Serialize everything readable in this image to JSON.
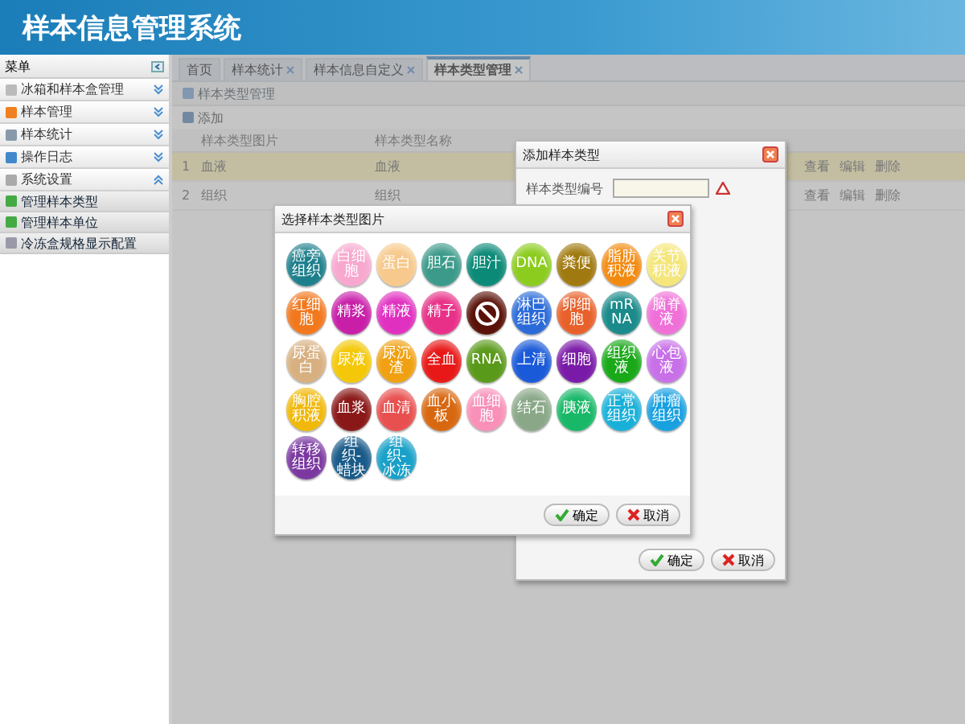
{
  "header": {
    "title": "样本信息管理系统"
  },
  "sidebar": {
    "title": "菜单",
    "items": [
      {
        "label": "冰箱和样本盒管理",
        "expanded": false
      },
      {
        "label": "样本管理",
        "expanded": false
      },
      {
        "label": "样本统计",
        "expanded": false
      },
      {
        "label": "操作日志",
        "expanded": false
      },
      {
        "label": "系统设置",
        "expanded": true,
        "children": [
          {
            "label": "管理样本类型"
          },
          {
            "label": "管理样本单位"
          },
          {
            "label": "冷冻盒规格显示配置"
          }
        ]
      }
    ]
  },
  "tabs": [
    {
      "label": "首页",
      "selected": false,
      "closable": false
    },
    {
      "label": "样本统计",
      "selected": false,
      "closable": true
    },
    {
      "label": "样本信息自定义",
      "selected": false,
      "closable": true
    },
    {
      "label": "样本类型管理",
      "selected": true,
      "closable": true
    }
  ],
  "panel": {
    "title": "样本类型管理",
    "add_label": "添加",
    "columns": [
      "样本类型图片",
      "样本类型名称"
    ],
    "rows": [
      {
        "index": "1",
        "image_text": "血液",
        "name": "血液",
        "selected": true,
        "actions": [
          "查看",
          "编辑",
          "删除"
        ]
      },
      {
        "index": "2",
        "image_text": "组织",
        "name": "组织",
        "selected": false,
        "actions": [
          "查看",
          "编辑",
          "删除"
        ]
      }
    ]
  },
  "add_dialog": {
    "title": "添加样本类型",
    "field_label": "样本类型编号",
    "buttons": [
      "确定",
      "取消"
    ]
  },
  "picker": {
    "title": "选择样本类型图片",
    "buttons": [
      "确定",
      "取消"
    ],
    "items": [
      {
        "kind": "text",
        "label": "癌旁组织",
        "color": "#1e7f8c"
      },
      {
        "kind": "text",
        "label": "白细胞",
        "color": "#f7a8cf"
      },
      {
        "kind": "text",
        "label": "蛋白",
        "color": "#f7c98c"
      },
      {
        "kind": "text",
        "label": "胆石",
        "color": "#3c9a8a"
      },
      {
        "kind": "text",
        "label": "胆汁",
        "color": "#0c8a78"
      },
      {
        "kind": "text",
        "label": "DNA",
        "color": "#8ccc1e"
      },
      {
        "kind": "text",
        "label": "粪便",
        "color": "#a07a10"
      },
      {
        "kind": "text",
        "label": "脂肪积液",
        "color": "#f28a10"
      },
      {
        "kind": "text",
        "label": "关节积液",
        "color": "#f4e67a"
      },
      {
        "kind": "text",
        "label": "红细胞",
        "color": "#f2781e"
      },
      {
        "kind": "text",
        "label": "精浆",
        "color": "#c81ea8"
      },
      {
        "kind": "text",
        "label": "精液",
        "color": "#e030c0"
      },
      {
        "kind": "text",
        "label": "精子",
        "color": "#e83088"
      },
      {
        "kind": "ban",
        "color": "#5a1208"
      },
      {
        "kind": "text",
        "label": "淋巴组织",
        "color": "#2a6ad8"
      },
      {
        "kind": "text",
        "label": "卵细胞",
        "color": "#e8602a"
      },
      {
        "kind": "text",
        "label": "mRNA",
        "color": "#1a8a8a"
      },
      {
        "kind": "text",
        "label": "脑脊液",
        "color": "#f070d8"
      },
      {
        "kind": "text",
        "label": "尿蛋白",
        "color": "#d8b080"
      },
      {
        "kind": "text",
        "label": "尿液",
        "color": "#f4c808"
      },
      {
        "kind": "text",
        "label": "尿沉渣",
        "color": "#f0a010"
      },
      {
        "kind": "text",
        "label": "全血",
        "color": "#e81818"
      },
      {
        "kind": "text",
        "label": "RNA",
        "color": "#5a9a1a"
      },
      {
        "kind": "text",
        "label": "上清",
        "color": "#1a5ad8"
      },
      {
        "kind": "text",
        "label": "细胞",
        "color": "#7a1aa8"
      },
      {
        "kind": "text",
        "label": "组织液",
        "color": "#18a818"
      },
      {
        "kind": "text",
        "label": "心包液",
        "color": "#c870e8"
      },
      {
        "kind": "text",
        "label": "胸腔积液",
        "color": "#f0b808"
      },
      {
        "kind": "text",
        "label": "血浆",
        "color": "#8a1818"
      },
      {
        "kind": "text",
        "label": "血清",
        "color": "#e85050"
      },
      {
        "kind": "text",
        "label": "血小板",
        "color": "#d86810"
      },
      {
        "kind": "text",
        "label": "血细胞",
        "color": "#f890b8"
      },
      {
        "kind": "text",
        "label": "结石",
        "color": "#8aa888"
      },
      {
        "kind": "text",
        "label": "胰液",
        "color": "#18b868"
      },
      {
        "kind": "text",
        "label": "正常组织",
        "color": "#18b0d8"
      },
      {
        "kind": "text",
        "label": "肿瘤组织",
        "color": "#18a0e0"
      },
      {
        "kind": "text",
        "label": "转移组织",
        "color": "#7a38a0"
      },
      {
        "kind": "text",
        "label": "组织-蜡块",
        "color": "#185a88"
      },
      {
        "kind": "text",
        "label": "组织-冰冻",
        "color": "#18a0c8"
      }
    ]
  }
}
